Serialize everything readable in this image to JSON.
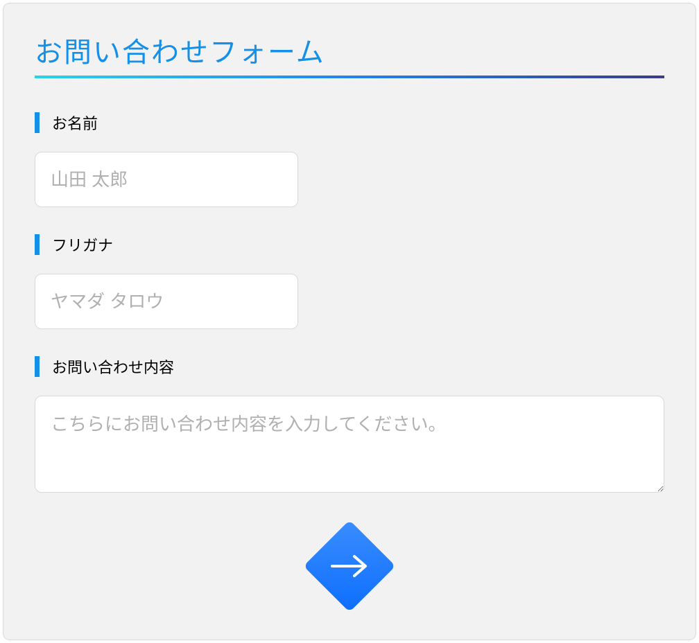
{
  "form": {
    "title": "お問い合わせフォーム",
    "fields": {
      "name": {
        "label": "お名前",
        "placeholder": "山田 太郎"
      },
      "furigana": {
        "label": "フリガナ",
        "placeholder": "ヤマダ タロウ"
      },
      "inquiry": {
        "label": "お問い合わせ内容",
        "placeholder": "こちらにお問い合わせ内容を入力してください。"
      }
    },
    "submit_icon": "arrow-right-icon"
  },
  "colors": {
    "accent": "#1590e8",
    "gradient_start": "#2ad2ec",
    "gradient_end": "#3b3b8a",
    "button_start": "#3a8dff",
    "button_end": "#0d6efd"
  }
}
